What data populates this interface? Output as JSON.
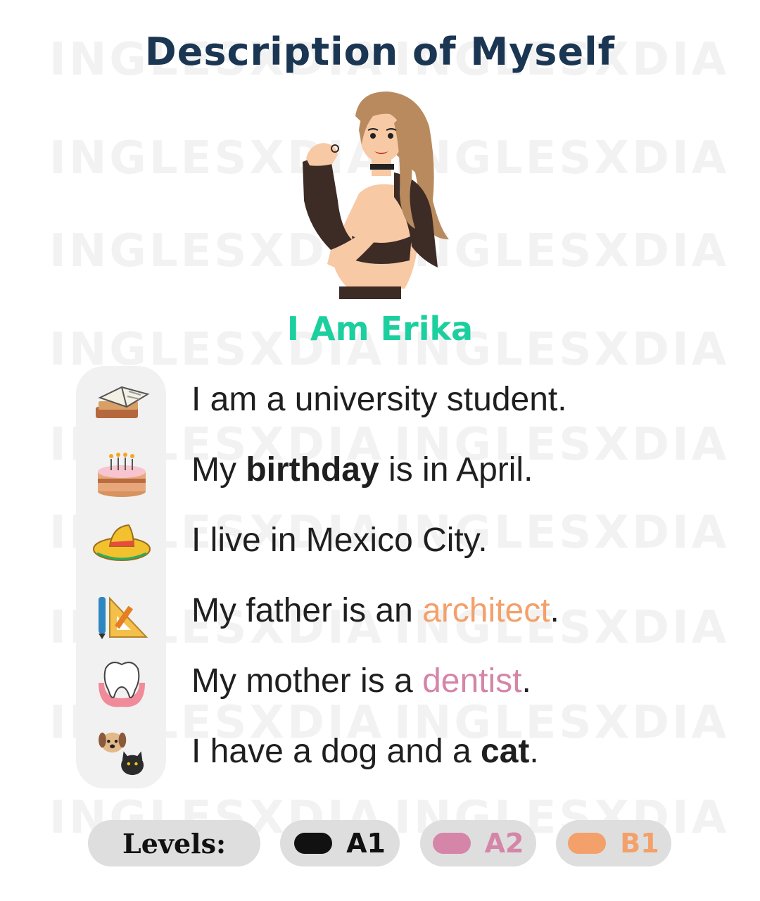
{
  "title": "Description of Myself",
  "name": "I Am Erika",
  "watermark": "INGLESXDIA",
  "sentences": [
    {
      "icon": "book-icon",
      "parts": [
        {
          "text": "I am a university student.",
          "style": "plain"
        }
      ]
    },
    {
      "icon": "birthday-cake-icon",
      "parts": [
        {
          "text": "My ",
          "style": "plain"
        },
        {
          "text": "birthday",
          "style": "bold"
        },
        {
          "text": " is in April.",
          "style": "plain"
        }
      ]
    },
    {
      "icon": "sombrero-icon",
      "parts": [
        {
          "text": "I live in Mexico City.",
          "style": "plain"
        }
      ]
    },
    {
      "icon": "ruler-pen-icon",
      "parts": [
        {
          "text": "My father is an ",
          "style": "plain"
        },
        {
          "text": "architect",
          "style": "b1"
        },
        {
          "text": ".",
          "style": "plain"
        }
      ]
    },
    {
      "icon": "tooth-icon",
      "parts": [
        {
          "text": "My mother is a ",
          "style": "plain"
        },
        {
          "text": "dentist",
          "style": "a2"
        },
        {
          "text": ".",
          "style": "plain"
        }
      ]
    },
    {
      "icon": "dog-cat-icon",
      "parts": [
        {
          "text": "I have a dog and a ",
          "style": "plain"
        },
        {
          "text": "cat",
          "style": "bold"
        },
        {
          "text": ".",
          "style": "plain"
        }
      ]
    }
  ],
  "levels": {
    "label": "Levels:",
    "items": [
      {
        "label": "A1",
        "color": "#111111",
        "text_color": "#111111"
      },
      {
        "label": "A2",
        "color": "#d585a8",
        "text_color": "#d585a8"
      },
      {
        "label": "B1",
        "color": "#f4a06a",
        "text_color": "#f4a06a"
      }
    ]
  },
  "colors": {
    "title": "#1a3652",
    "name": "#1ccf9e",
    "a2": "#d585a8",
    "b1": "#f4a06a"
  }
}
